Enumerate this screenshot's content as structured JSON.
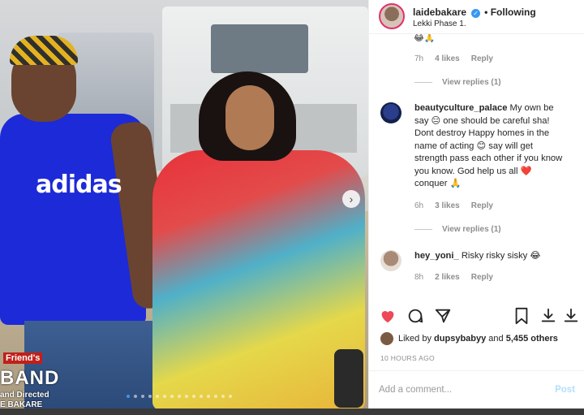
{
  "post": {
    "username": "laidebakare",
    "verified_symbol": "✓",
    "follow_state": "Following",
    "location": "Lekki Phase 1.",
    "photo": {
      "shirt_text": "adidas",
      "poster_line1": "Friend's",
      "poster_line2": "BAND",
      "poster_line3": "and Directed",
      "poster_line4": "E BAKARE",
      "next_glyph": "›"
    }
  },
  "comments": {
    "top_emoji": "😂🙏",
    "first_meta": {
      "time": "7h",
      "likes": "4 likes",
      "reply": "Reply"
    },
    "view_replies_1": "View replies (1)",
    "c1": {
      "author": "beautyculture_palace",
      "text": "My own be say 😑 one should be careful sha! Dont destroy Happy homes in the name of acting 😊 say will get strength pass each other if you know you know. God help us all ❤️ conquer 🙏",
      "time": "6h",
      "likes": "3 likes",
      "reply": "Reply"
    },
    "view_replies_2": "View replies (1)",
    "c2": {
      "author": "hey_yoni_",
      "text": "Risky risky sisky 😂",
      "time": "8h",
      "likes": "2 likes",
      "reply": "Reply"
    }
  },
  "likes_line": {
    "prefix": "Liked by",
    "user": "dupsybabyy",
    "middle": "and",
    "count": "5,455 others"
  },
  "timestamp": "10 HOURS AGO",
  "add_comment": {
    "placeholder": "Add a comment...",
    "post_label": "Post"
  },
  "colors": {
    "like_heart": "#ed4956",
    "verified": "#3897f0",
    "link_blue": "#b2dffc"
  }
}
